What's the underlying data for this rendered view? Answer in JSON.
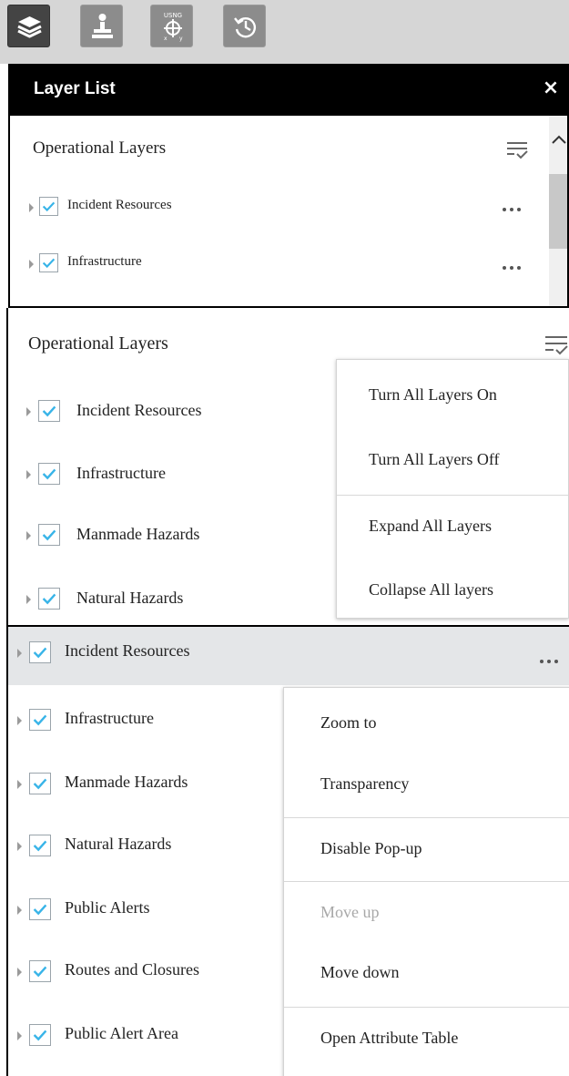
{
  "toolbar": {
    "buttons": [
      {
        "icon": "layers-icon",
        "active": true
      },
      {
        "icon": "legend-icon",
        "active": false
      },
      {
        "icon": "usng-coordinate-icon",
        "text": "USNG",
        "active": false
      },
      {
        "icon": "history-icon",
        "active": false
      }
    ]
  },
  "panel1": {
    "title": "Layer List",
    "close": "×",
    "section_title": "Operational Layers",
    "layers": [
      "Incident Resources",
      "Infrastructure"
    ]
  },
  "panel2": {
    "section_title": "Operational Layers",
    "layers": [
      "Incident Resources",
      "Infrastructure",
      "Manmade Hazards",
      "Natural Hazards"
    ],
    "menu": [
      "Turn All Layers On",
      "Turn All Layers Off",
      "Expand All Layers",
      "Collapse All layers"
    ]
  },
  "panel3": {
    "selected_layer": "Incident Resources",
    "layers": [
      "Infrastructure",
      "Manmade Hazards",
      "Natural Hazards",
      "Public Alerts",
      "Routes and Closures",
      "Public Alert Area"
    ],
    "menu": [
      {
        "label": "Zoom to",
        "disabled": false
      },
      {
        "label": "Transparency",
        "disabled": false
      },
      {
        "label": "Disable Pop-up",
        "disabled": false
      },
      {
        "label": "Move up",
        "disabled": true
      },
      {
        "label": "Move down",
        "disabled": false
      },
      {
        "label": "Open Attribute Table",
        "disabled": false
      }
    ]
  },
  "colors": {
    "check": "#38b4e8",
    "header_bg": "#000000",
    "toolbar_bg": "#d6d6d6",
    "selected_row_bg": "#e4e6e8",
    "disabled_text": "#a8a8a8"
  }
}
